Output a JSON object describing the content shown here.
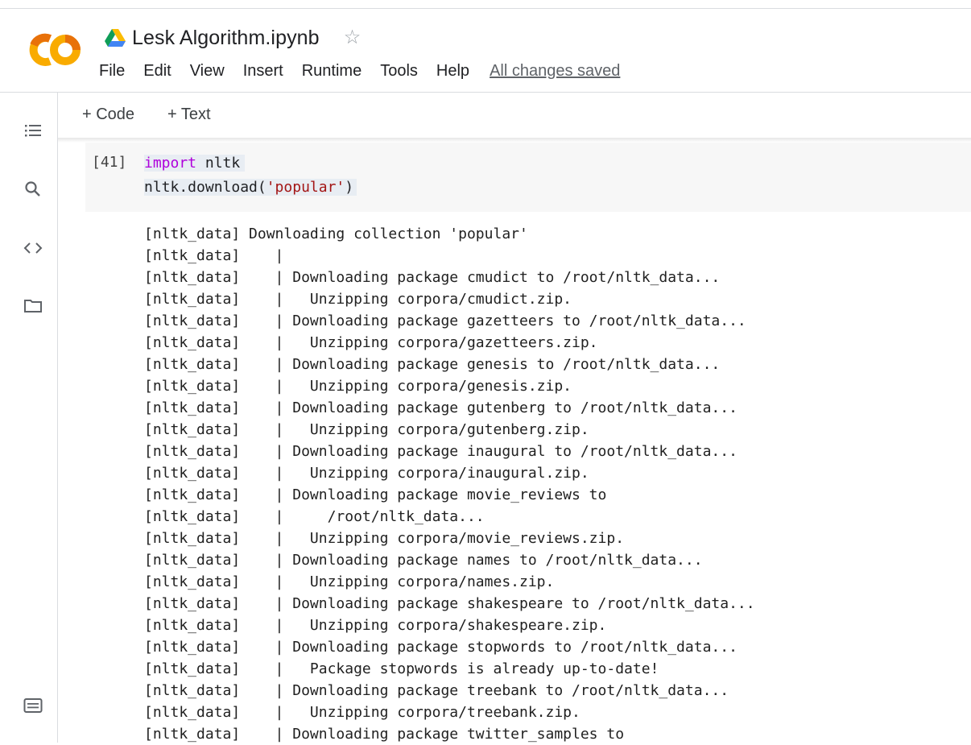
{
  "app": {
    "title": "Lesk Algorithm.ipynb",
    "logo_text": "CO"
  },
  "menu": {
    "items": [
      "File",
      "Edit",
      "View",
      "Insert",
      "Runtime",
      "Tools",
      "Help"
    ],
    "saved_status": "All changes saved"
  },
  "toolbar": {
    "add_code_label": "+ Code",
    "add_text_label": "+ Text"
  },
  "sidebar": {
    "icons": [
      "table-of-contents-icon",
      "search-icon",
      "code-snippets-icon",
      "files-icon",
      "terminal-icon"
    ]
  },
  "cell": {
    "execution_count": "[41]",
    "code_line1_keyword": "import",
    "code_line1_rest": " nltk",
    "code_line2_prefix": "nltk.download(",
    "code_line2_string": "'popular'",
    "code_line2_suffix": ")"
  },
  "output": {
    "lines": [
      "[nltk_data] Downloading collection 'popular'",
      "[nltk_data]    |",
      "[nltk_data]    | Downloading package cmudict to /root/nltk_data...",
      "[nltk_data]    |   Unzipping corpora/cmudict.zip.",
      "[nltk_data]    | Downloading package gazetteers to /root/nltk_data...",
      "[nltk_data]    |   Unzipping corpora/gazetteers.zip.",
      "[nltk_data]    | Downloading package genesis to /root/nltk_data...",
      "[nltk_data]    |   Unzipping corpora/genesis.zip.",
      "[nltk_data]    | Downloading package gutenberg to /root/nltk_data...",
      "[nltk_data]    |   Unzipping corpora/gutenberg.zip.",
      "[nltk_data]    | Downloading package inaugural to /root/nltk_data...",
      "[nltk_data]    |   Unzipping corpora/inaugural.zip.",
      "[nltk_data]    | Downloading package movie_reviews to",
      "[nltk_data]    |     /root/nltk_data...",
      "[nltk_data]    |   Unzipping corpora/movie_reviews.zip.",
      "[nltk_data]    | Downloading package names to /root/nltk_data...",
      "[nltk_data]    |   Unzipping corpora/names.zip.",
      "[nltk_data]    | Downloading package shakespeare to /root/nltk_data...",
      "[nltk_data]    |   Unzipping corpora/shakespeare.zip.",
      "[nltk_data]    | Downloading package stopwords to /root/nltk_data...",
      "[nltk_data]    |   Package stopwords is already up-to-date!",
      "[nltk_data]    | Downloading package treebank to /root/nltk_data...",
      "[nltk_data]    |   Unzipping corpora/treebank.zip.",
      "[nltk_data]    | Downloading package twitter_samples to"
    ]
  },
  "colors": {
    "logo_orange": "#f9ab00",
    "logo_dark_orange": "#e8710a",
    "keyword": "#af00db",
    "string": "#a31515"
  }
}
